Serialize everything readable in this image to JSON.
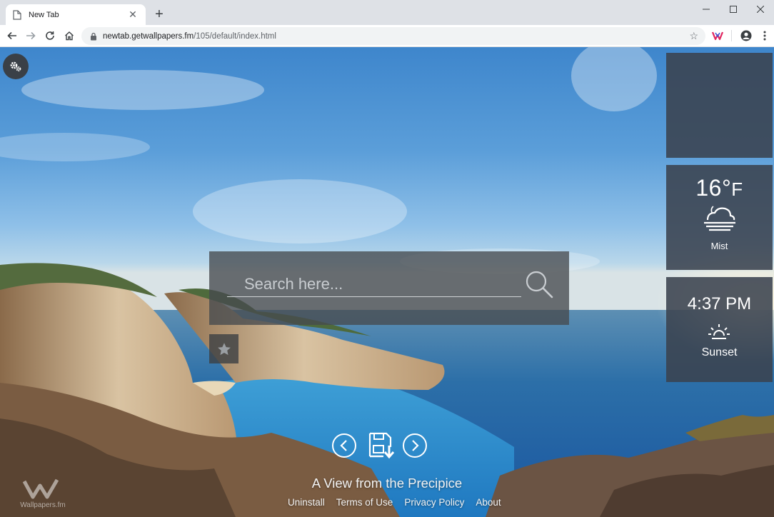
{
  "browser": {
    "tab_title": "New Tab",
    "url_host": "newtab.getwallpapers.fm",
    "url_path": "/105/default/index.html"
  },
  "weather": {
    "temperature": "16°",
    "unit": "F",
    "condition": "Mist"
  },
  "sun": {
    "time": "4:37 PM",
    "label": "Sunset"
  },
  "search": {
    "placeholder": "Search here..."
  },
  "wallpaper": {
    "caption": "A View from the Precipice"
  },
  "footer": {
    "links": [
      "Uninstall",
      "Terms of Use",
      "Privacy Policy",
      "About"
    ]
  },
  "brand": {
    "name": "Wallpapers.fm"
  },
  "colors": {
    "widget_bg": "#3a424e",
    "chrome_bg": "#dee1e6"
  }
}
